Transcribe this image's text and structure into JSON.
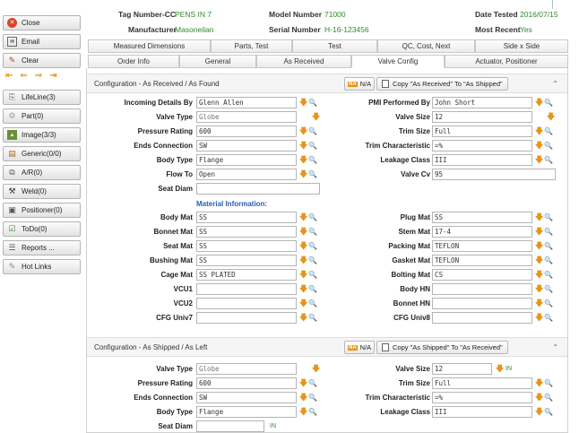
{
  "sidebar": {
    "close": "Close",
    "email": "Email",
    "clear": "Clear",
    "items": [
      {
        "label": "LifeLine(3)",
        "icon": "lifeline-icon"
      },
      {
        "label": "Part(0)",
        "icon": "part-icon"
      },
      {
        "label": "Image(3/3)",
        "icon": "image-icon"
      },
      {
        "label": "Generic(0/0)",
        "icon": "generic-icon"
      },
      {
        "label": "A/R(0)",
        "icon": "ar-icon"
      },
      {
        "label": "Weld(0)",
        "icon": "weld-icon"
      },
      {
        "label": "Positioner(0)",
        "icon": "positioner-icon"
      },
      {
        "label": "ToDo(0)",
        "icon": "todo-icon"
      },
      {
        "label": "Reports ...",
        "icon": "reports-icon"
      },
      {
        "label": "Hot Links",
        "icon": "hotlinks-icon"
      }
    ]
  },
  "header": {
    "tag_label": "Tag Number-CC",
    "tag_value": "PENS IN 7",
    "model_label": "Model Number",
    "model_value": "71000",
    "date_label": "Date Tested",
    "date_value": "2016/07/15",
    "manufacturer_label": "Manufacturer",
    "manufacturer_value": "Masoneilan",
    "serial_label": "Serial Number",
    "serial_value": "H-16-123456",
    "recent_label": "Most Recent",
    "recent_value": "Yes"
  },
  "tabs_row1": [
    "Measured Dimensions",
    "Parts, Test",
    "Test",
    "QC, Cost, Next",
    "Side x Side"
  ],
  "tabs_row2": [
    "Order Info",
    "General",
    "As Received",
    "Valve Config",
    "Actuator, Positioner"
  ],
  "active_tab": "Valve Config",
  "section1": {
    "title": "Configuration - As Received / As Found",
    "na_label": "N/A",
    "na_badge": "NA",
    "copy_label": "Copy \"As Received\" To \"As Shipped\"",
    "left": [
      {
        "label": "Incoming Details By",
        "value": "Glenn Allen"
      },
      {
        "label": "Valve Type",
        "value": "Globe"
      },
      {
        "label": "Pressure Rating",
        "value": "600"
      },
      {
        "label": "Ends Connection",
        "value": "SW"
      },
      {
        "label": "Body Type",
        "value": "Flange"
      },
      {
        "label": "Flow To",
        "value": "Open"
      },
      {
        "label": "Seat Diam",
        "value": ""
      }
    ],
    "right": [
      {
        "label": "PMI Performed By",
        "value": "John Short"
      },
      {
        "label": "Valve Size",
        "value": "12"
      },
      {
        "label": "Trim Size",
        "value": "Full"
      },
      {
        "label": "Trim Characteristic",
        "value": "=%"
      },
      {
        "label": "Leakage Class",
        "value": "III"
      },
      {
        "label": "Valve Cv",
        "value": "95"
      }
    ],
    "material_heading": "Material Information:",
    "mat_left": [
      {
        "label": "Body Mat",
        "value": "SS"
      },
      {
        "label": "Bonnet Mat",
        "value": "SS"
      },
      {
        "label": "Seat Mat",
        "value": "SS"
      },
      {
        "label": "Bushing Mat",
        "value": "SS"
      },
      {
        "label": "Cage Mat",
        "value": "SS PLATED"
      },
      {
        "label": "VCU1",
        "value": ""
      },
      {
        "label": "VCU2",
        "value": ""
      },
      {
        "label": "CFG Univ7",
        "value": ""
      }
    ],
    "mat_right": [
      {
        "label": "Plug Mat",
        "value": "SS"
      },
      {
        "label": "Stem Mat",
        "value": "17-4"
      },
      {
        "label": "Packing Mat",
        "value": "TEFLON"
      },
      {
        "label": "Gasket Mat",
        "value": "TEFLON"
      },
      {
        "label": "Bolting Mat",
        "value": "CS"
      },
      {
        "label": "Body HN",
        "value": ""
      },
      {
        "label": "Bonnet HN",
        "value": ""
      },
      {
        "label": "CFG Univ8",
        "value": ""
      }
    ]
  },
  "section2": {
    "title": "Configuration - As Shipped / As Left",
    "na_label": "N/A",
    "na_badge": "NA",
    "copy_label": "Copy \"As Shipped\" To \"As Received\"",
    "in_label": "IN",
    "left": [
      {
        "label": "Valve Type",
        "value": "Globe"
      },
      {
        "label": "Pressure Rating",
        "value": "600"
      },
      {
        "label": "Ends Connection",
        "value": "SW"
      },
      {
        "label": "Body Type",
        "value": "Flange"
      },
      {
        "label": "Seat Diam",
        "value": ""
      }
    ],
    "right": [
      {
        "label": "Valve Size",
        "value": "12"
      },
      {
        "label": "Trim Size",
        "value": "Full"
      },
      {
        "label": "Trim Characteristic",
        "value": "=%"
      },
      {
        "label": "Leakage Class",
        "value": "III"
      }
    ]
  }
}
